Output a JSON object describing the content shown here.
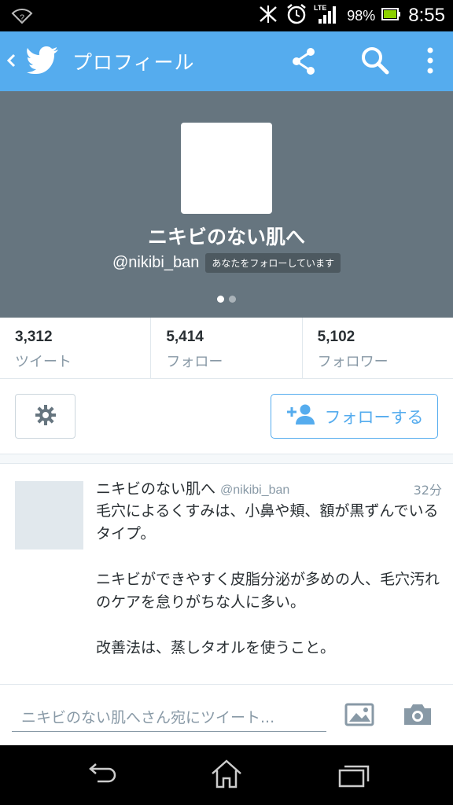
{
  "status_bar": {
    "battery": "98%",
    "time": "8:55",
    "network": "LTE"
  },
  "app_bar": {
    "title": "プロフィール"
  },
  "profile": {
    "display_name": "ニキビのない肌へ",
    "handle": "@nikibi_ban",
    "follows_you_badge": "あなたをフォローしています",
    "header_color": "#66757f"
  },
  "stats": [
    {
      "count": "3,312",
      "label": "ツイート"
    },
    {
      "count": "5,414",
      "label": "フォロー"
    },
    {
      "count": "5,102",
      "label": "フォロワー"
    }
  ],
  "actions": {
    "follow_label": "フォローする"
  },
  "tweet": {
    "name": "ニキビのない肌へ",
    "handle": "@nikibi_ban",
    "time": "32分",
    "paragraphs": [
      "毛穴によるくすみは、小鼻や頬、額が黒ずんでいるタイプ。",
      "ニキビができやすく皮脂分泌が多めの人、毛穴汚れのケアを怠りがちな人に多い。",
      "改善法は、蒸しタオルを使うこと。"
    ]
  },
  "compose": {
    "placeholder": "ニキビのない肌へさん宛にツイート..."
  },
  "colors": {
    "accent": "#55acee",
    "text": "#292f33",
    "muted": "#8899a6"
  },
  "icons": [
    "wifi-icon",
    "vibrate-icon",
    "alarm-icon",
    "signal-icon",
    "battery-icon",
    "back-chevron-icon",
    "twitter-bird-icon",
    "share-icon",
    "search-icon",
    "more-icon",
    "gear-icon",
    "add-user-icon",
    "photo-icon",
    "camera-icon",
    "nav-back-icon",
    "nav-home-icon",
    "nav-recent-icon"
  ]
}
